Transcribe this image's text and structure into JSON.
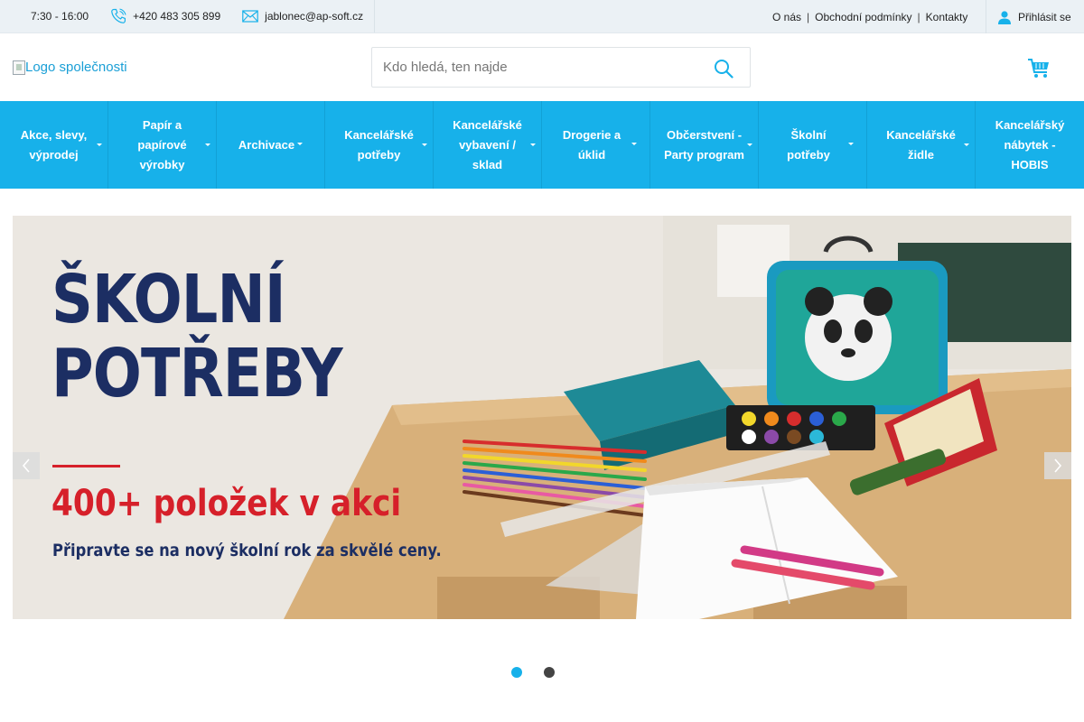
{
  "topbar": {
    "hours": "7:30 - 16:00",
    "phone": "+420 483 305 899",
    "email": "jablonec@ap-soft.cz",
    "links": [
      "O nás",
      "Obchodní podmínky",
      "Kontakty"
    ],
    "separator": "|",
    "login_label": "Přihlásit se"
  },
  "header": {
    "logo_alt": "Logo společnosti",
    "search_placeholder": "Kdo hledá, ten najde"
  },
  "nav": {
    "items": [
      {
        "label": "Akce, slevy,\nvýprodej",
        "has_dropdown": true
      },
      {
        "label": "Papír a\npapírové\nvýrobky",
        "has_dropdown": true
      },
      {
        "label": "Archivace",
        "has_dropdown": true
      },
      {
        "label": "Kancelářské\npotřeby",
        "has_dropdown": true
      },
      {
        "label": "Kancelářské\nvybavení /\nsklad",
        "has_dropdown": true
      },
      {
        "label": "Drogerie a úklid",
        "has_dropdown": true
      },
      {
        "label": "Občerstvení -\nParty program",
        "has_dropdown": true
      },
      {
        "label": "Školní potřeby",
        "has_dropdown": true
      },
      {
        "label": "Kancelářské\nžidle",
        "has_dropdown": true
      },
      {
        "label": "Kancelářský\nnábytek - HOBIS",
        "has_dropdown": false
      }
    ]
  },
  "banner": {
    "heading_line1": "ŠKOLNÍ",
    "heading_line2": "POTŘEBY",
    "promo": "400+ položek v akci",
    "subtitle": "Připravte se na nový školní rok za skvělé ceny.",
    "slide_count": 2,
    "active_slide": 1
  },
  "colors": {
    "accent": "#17b1ea",
    "heading": "#1c2e63",
    "promo_red": "#d6202a",
    "topbar_bg": "#ebf1f5"
  },
  "icons": {
    "phone": "phone-icon",
    "email": "envelope-icon",
    "user": "user-icon",
    "search": "search-icon",
    "cart": "cart-icon",
    "prev": "chevron-left-icon",
    "next": "chevron-right-icon"
  }
}
